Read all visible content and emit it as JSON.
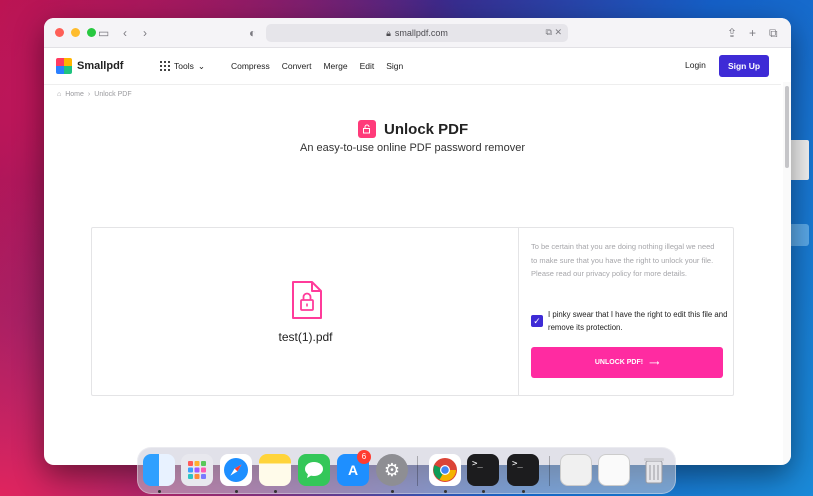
{
  "browser": {
    "url": "smallpdf.com"
  },
  "header": {
    "logo_text": "Smallpdf",
    "tools_label": "Tools",
    "nav": [
      "Compress",
      "Convert",
      "Merge",
      "Edit",
      "Sign"
    ],
    "login_label": "Login",
    "signup_label": "Sign Up"
  },
  "breadcrumb": {
    "home": "Home",
    "separator": "›",
    "current": "Unlock PDF"
  },
  "page": {
    "title": "Unlock PDF",
    "subtitle": "An easy-to-use online PDF password remover"
  },
  "file": {
    "name": "test(1).pdf"
  },
  "notice": {
    "text": "To be certain that you are doing nothing illegal we need to make sure that you have the right to unlock your file. Please read our privacy policy for more details."
  },
  "consent": {
    "checked": true,
    "text": "I pinky swear that I have the right to edit this file and remove its protection."
  },
  "action": {
    "unlock_label": "UNLOCK PDF!"
  },
  "dock": {
    "badge_count": "6",
    "icons": [
      "finder-icon",
      "launchpad-icon",
      "safari-icon",
      "notes-icon",
      "messages-icon",
      "app-store-icon",
      "system-preferences-icon",
      "chrome-icon",
      "terminal-icon",
      "terminal-icon",
      "window-preview-icon",
      "window-preview-icon",
      "trash-icon"
    ]
  },
  "colors": {
    "brand": "#3e2bd6",
    "accent": "#ff2ba1",
    "title_badge": "#ff3b7a"
  }
}
